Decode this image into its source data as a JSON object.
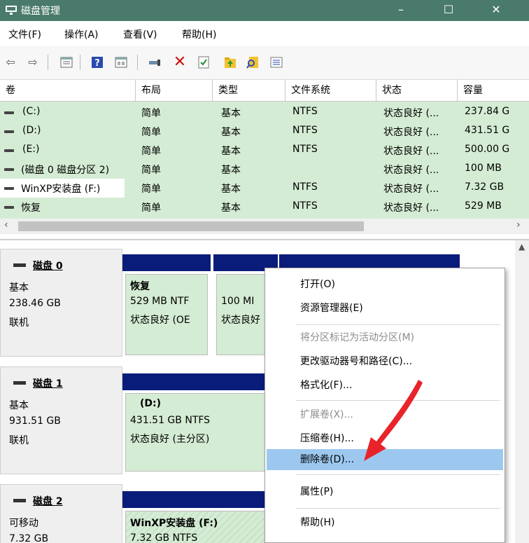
{
  "window": {
    "title": "磁盘管理",
    "controls": [
      "–",
      "☐",
      "✕"
    ]
  },
  "menu": [
    "文件(F)",
    "操作(A)",
    "查看(V)",
    "帮助(H)"
  ],
  "toolbar_icons": [
    "back-icon",
    "forward-icon",
    "properties-list-icon",
    "help-icon",
    "show-pane-icon",
    "connect-icon",
    "delete-icon",
    "check-icon",
    "new-folder-icon",
    "search-icon",
    "list-view-icon"
  ],
  "volumes": {
    "columns": [
      "卷",
      "布局",
      "类型",
      "文件系统",
      "状态",
      "容量"
    ],
    "rows": [
      [
        "(C:)",
        "简单",
        "基本",
        "NTFS",
        "状态良好 (...",
        "237.84 G"
      ],
      [
        "(D:)",
        "简单",
        "基本",
        "NTFS",
        "状态良好 (...",
        "431.51 G"
      ],
      [
        "(E:)",
        "简单",
        "基本",
        "NTFS",
        "状态良好 (...",
        "500.00 G"
      ],
      [
        "(磁盘 0 磁盘分区 2)",
        "简单",
        "基本",
        "",
        "状态良好 (...",
        "100 MB"
      ],
      [
        "WinXP安装盘 (F:)",
        "简单",
        "基本",
        "NTFS",
        "状态良好 (...",
        "7.32 GB"
      ],
      [
        "恢复",
        "简单",
        "基本",
        "NTFS",
        "状态良好 (...",
        "529 MB"
      ]
    ]
  },
  "disks": [
    {
      "name": "磁盘 0",
      "type": "基本",
      "size": "238.46 GB",
      "status": "联机",
      "parts": [
        {
          "line1": "恢复",
          "line2": "529 MB NTF",
          "line3": "状态良好 (OE"
        },
        {
          "line1": "",
          "line2": "100 MI",
          "line3": "状态良好"
        }
      ]
    },
    {
      "name": "磁盘 1",
      "type": "基本",
      "size": "931.51 GB",
      "status": "联机",
      "parts": [
        {
          "line1": "(D:)",
          "line2": "431.51 GB NTFS",
          "line3": "状态良好 (主分区)"
        }
      ]
    },
    {
      "name": "磁盘 2",
      "type": "可移动",
      "size": "7.32 GB",
      "parts": [
        {
          "line1": "WinXP安装盘  (F:)",
          "line2": "7.32 GB NTFS"
        }
      ]
    }
  ],
  "context_menu": {
    "items": [
      {
        "label": "打开(O)",
        "enabled": true
      },
      {
        "label": "资源管理器(E)",
        "enabled": true
      },
      {
        "label": "将分区标记为活动分区(M)",
        "enabled": false
      },
      {
        "label": "更改驱动器号和路径(C)...",
        "enabled": true
      },
      {
        "label": "格式化(F)...",
        "enabled": true
      },
      {
        "label": "扩展卷(X)...",
        "enabled": false
      },
      {
        "label": "压缩卷(H)...",
        "enabled": true
      },
      {
        "label": "删除卷(D)...",
        "enabled": true,
        "highlighted": true
      },
      {
        "label": "属性(P)",
        "enabled": true
      },
      {
        "label": "帮助(H)",
        "enabled": true
      }
    ]
  },
  "colors": {
    "titlebar": "#4a7a6b",
    "volume_row": "#d4ecd4",
    "partition_band": "#0a1c7a",
    "menu_highlight": "#9cc8f0",
    "annotation_arrow": "#e8242a"
  }
}
